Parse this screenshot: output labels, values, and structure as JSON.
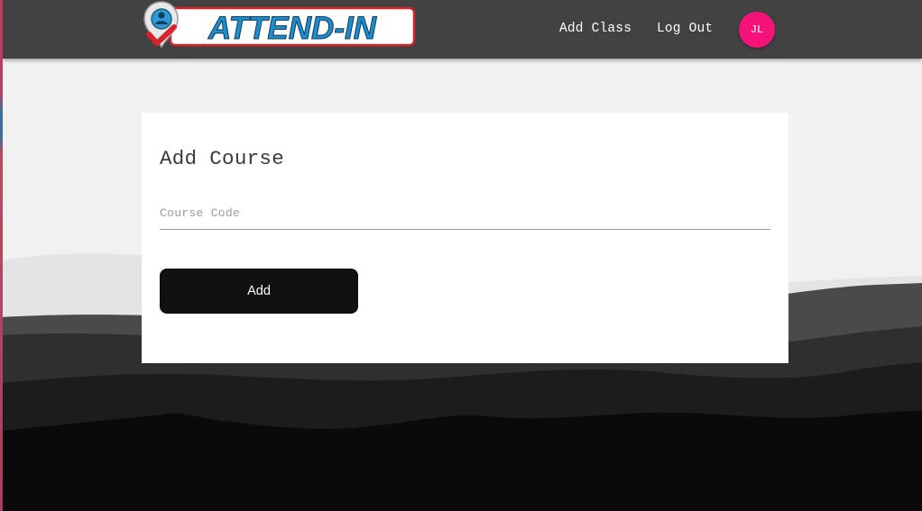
{
  "app": {
    "logo_text": "ATTEND-IN"
  },
  "nav": {
    "links": [
      {
        "label": "Add Class"
      },
      {
        "label": "Log Out"
      }
    ],
    "avatar_initials": "JL",
    "avatar_color": "#f5137a"
  },
  "form": {
    "title": "Add Course",
    "course_code": {
      "value": "",
      "placeholder": "Course Code"
    },
    "submit_label": "Add"
  },
  "colors": {
    "navbar": "#424242",
    "page_background": "#f1f1f1",
    "card": "#ffffff",
    "button": "#111111",
    "logo_blue": "#1f8dc9",
    "logo_red": "#d8232a"
  }
}
